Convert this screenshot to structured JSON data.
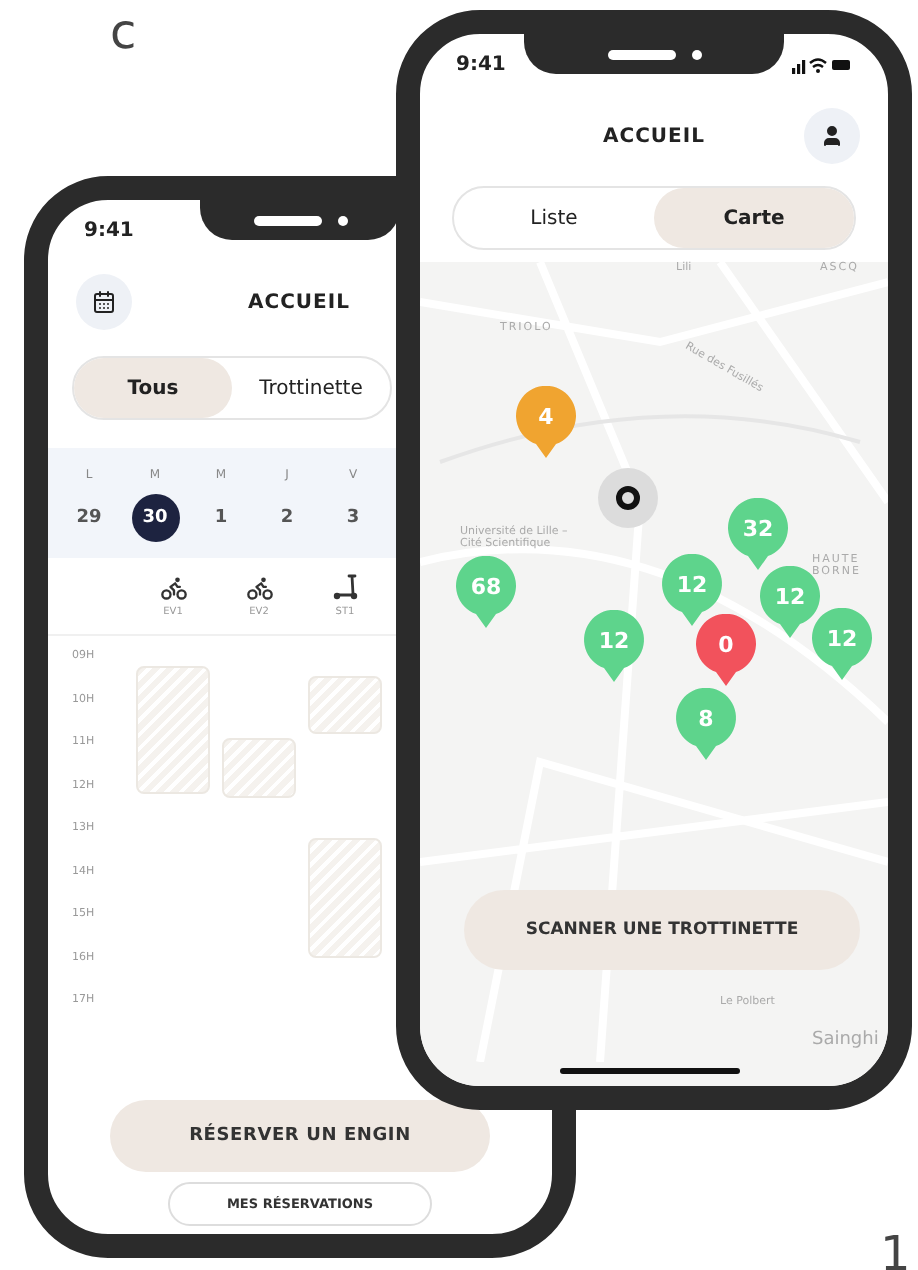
{
  "top_left_text": "c",
  "bottom_right_text": "1",
  "back_phone": {
    "time": "9:41",
    "title": "ACCUEIL",
    "tabs": [
      {
        "label": "Tous",
        "selected": true
      },
      {
        "label": "Trottinette",
        "selected": false
      }
    ],
    "days": [
      {
        "letter": "L",
        "number": "29",
        "selected": false
      },
      {
        "letter": "M",
        "number": "30",
        "selected": true
      },
      {
        "letter": "M",
        "number": "1",
        "selected": false
      },
      {
        "letter": "J",
        "number": "2",
        "selected": false
      },
      {
        "letter": "V",
        "number": "3",
        "selected": false
      }
    ],
    "vehicles": [
      {
        "kind": "bike",
        "code": "EV1"
      },
      {
        "kind": "bike",
        "code": "EV2"
      },
      {
        "kind": "scooter",
        "code": "ST1"
      }
    ],
    "hours": [
      "09H",
      "10H",
      "11H",
      "12H",
      "13H",
      "14H",
      "15H",
      "16H",
      "17H"
    ],
    "primary_button": "RÉSERVER UN ENGIN",
    "secondary_button": "MES RÉSERVATIONS"
  },
  "front_phone": {
    "time": "9:41",
    "title": "ACCUEIL",
    "tabs": [
      {
        "label": "Liste",
        "selected": false
      },
      {
        "label": "Carte",
        "selected": true
      }
    ],
    "map_labels": [
      {
        "text": "Lili",
        "kind": "place"
      },
      {
        "text": "ASCQ",
        "kind": "district"
      },
      {
        "text": "TRIOLO",
        "kind": "district"
      },
      {
        "text": "Rue des Fusillés",
        "kind": "street"
      },
      {
        "text": "Université de Lille – Cité Scientifique",
        "kind": "place"
      },
      {
        "text": "HAUTE BORNE",
        "kind": "district"
      },
      {
        "text": "Le Polbert",
        "kind": "place"
      },
      {
        "text": "Sainghi",
        "kind": "town"
      }
    ],
    "pins": [
      {
        "count": "4",
        "color": "#f0a430"
      },
      {
        "count": "68",
        "color": "#5ed48c"
      },
      {
        "count": "32",
        "color": "#5ed48c"
      },
      {
        "count": "12",
        "color": "#5ed48c"
      },
      {
        "count": "12",
        "color": "#5ed48c"
      },
      {
        "count": "12",
        "color": "#5ed48c"
      },
      {
        "count": "0",
        "color": "#f2525c"
      },
      {
        "count": "12",
        "color": "#5ed48c"
      },
      {
        "count": "8",
        "color": "#5ed48c"
      }
    ],
    "scan_button": "SCANNER UNE TROTTINETTE"
  }
}
